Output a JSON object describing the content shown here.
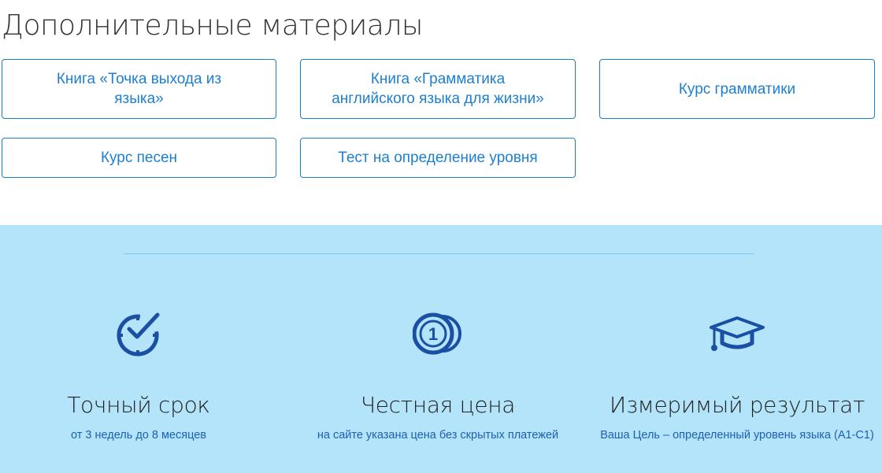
{
  "section_title": "Дополнительные материалы",
  "materials": [
    {
      "line1": "Книга «Точка выхода из",
      "line2": "языка»"
    },
    {
      "line1": "Книга «Грамматика",
      "line2": "английского языка для жизни»"
    },
    {
      "label": "Курс грамматики"
    },
    {
      "label": "Курс песен"
    },
    {
      "label": "Тест на определение уровня"
    }
  ],
  "features": [
    {
      "icon": "clock-check-icon",
      "title": "Точный срок",
      "subtitle": "от 3 недель до 8 месяцев"
    },
    {
      "icon": "coin-icon",
      "title": "Честная цена",
      "subtitle": "на сайте указана цена без скрытых платежей"
    },
    {
      "icon": "graduation-cap-icon",
      "title": "Измеримый результат",
      "subtitle": "Ваша Цель – определенный уровень языка (А1-С1)"
    }
  ],
  "colors": {
    "accent": "#1e7fd0",
    "band": "#b3e4fa",
    "icon": "#1a4fa3"
  }
}
